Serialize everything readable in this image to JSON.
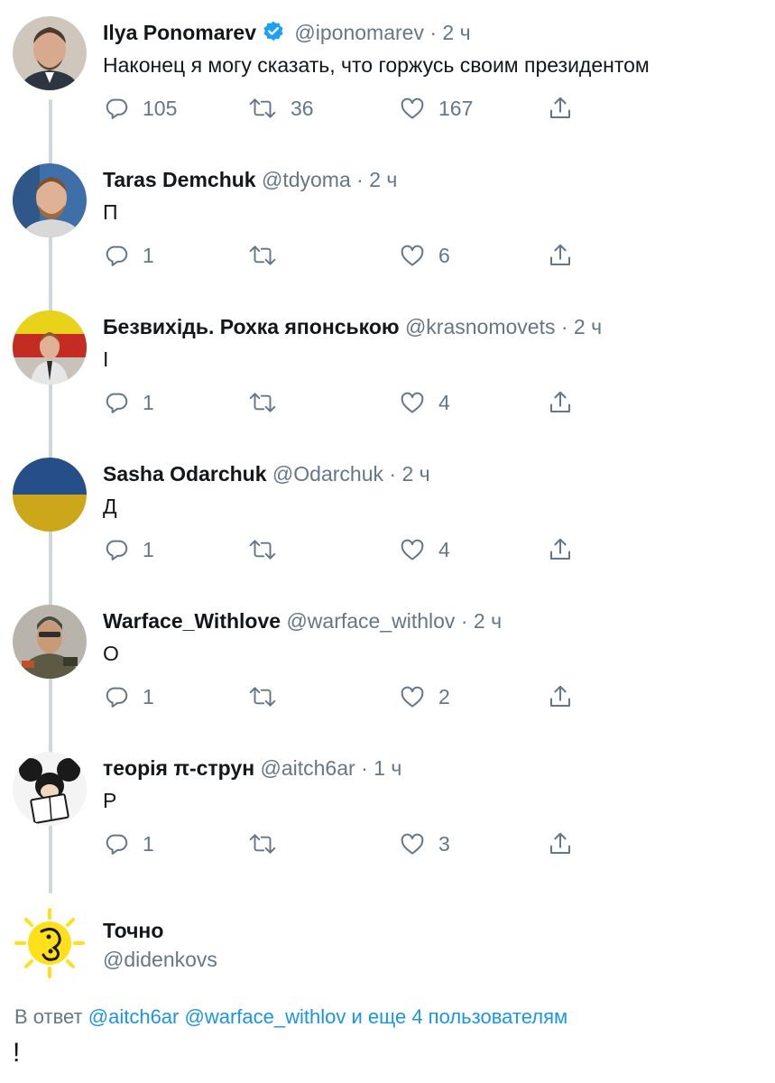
{
  "tweets": [
    {
      "name": "Ilya Ponomarev",
      "verified": true,
      "handle": "@iponomarev",
      "time": "2 ч",
      "text": "Наконец я могу сказать, что горжусь своим президентом",
      "replies": "105",
      "retweets": "36",
      "likes": "167",
      "avatar": "man-avatar-icon"
    },
    {
      "name": "Taras Demchuk",
      "verified": false,
      "handle": "@tdyoma",
      "time": "2 ч",
      "text": "П",
      "replies": "1",
      "retweets": "",
      "likes": "6",
      "avatar": "man-avatar-icon"
    },
    {
      "name": "Безвихідь. Рохка японською",
      "verified": false,
      "handle": "@krasnomovets",
      "time": "2 ч",
      "text": "І",
      "replies": "1",
      "retweets": "",
      "likes": "4",
      "avatar": "man-avatar-icon"
    },
    {
      "name": "Sasha Odarchuk",
      "verified": false,
      "handle": "@Odarchuk",
      "time": "2 ч",
      "text": "Д",
      "replies": "1",
      "retweets": "",
      "likes": "4",
      "avatar": "flag-avatar-icon"
    },
    {
      "name": "Warface_Withlove",
      "verified": false,
      "handle": "@warface_withlov",
      "time": "2 ч",
      "text": "О",
      "replies": "1",
      "retweets": "",
      "likes": "2",
      "avatar": "soldier-avatar-icon"
    },
    {
      "name": "теорія π-струн",
      "verified": false,
      "handle": "@aitch6ar",
      "time": "1 ч",
      "text": "Р",
      "replies": "1",
      "retweets": "",
      "likes": "3",
      "avatar": "mouse-avatar-icon"
    }
  ],
  "main_tweet": {
    "name": "Точно",
    "handle": "@didenkovs",
    "reply_prefix": "В ответ",
    "reply_mentions": [
      "@aitch6ar",
      "@warface_withlov"
    ],
    "reply_suffix": "и еще 4 пользователям",
    "text": "!"
  },
  "separator": "·",
  "colors": {
    "text": "#14171a",
    "secondary": "#657786",
    "link": "#1b95e0",
    "verified": "#1da1f2",
    "thread_line": "#cfd6dc"
  }
}
